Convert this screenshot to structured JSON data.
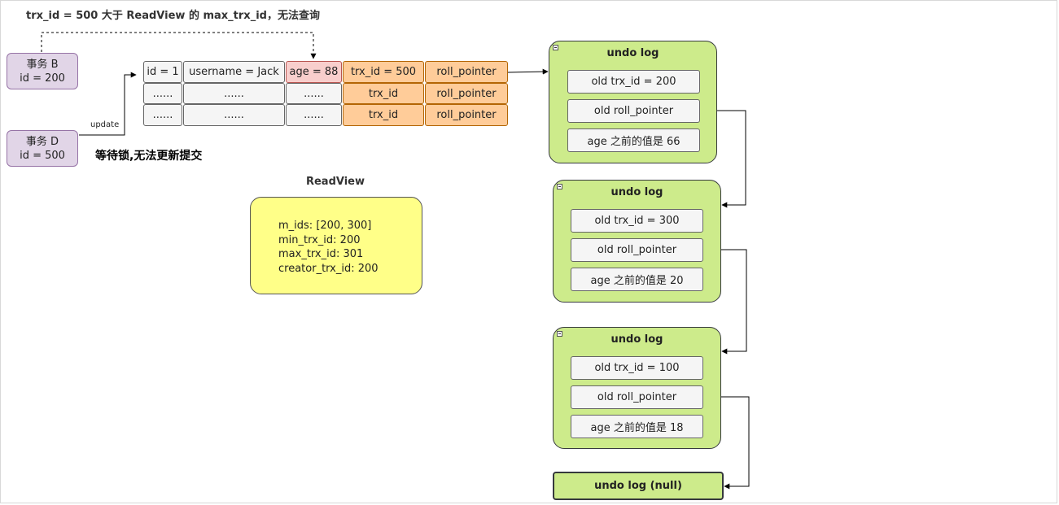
{
  "title": "trx_id = 500 大于 ReadView 的 max_trx_id，无法查询",
  "transactions": [
    {
      "name": "事务 B",
      "id": "id = 200"
    },
    {
      "name": "事务 D",
      "id": "id = 500"
    }
  ],
  "update_label": "update",
  "wait_note": "等待锁,无法更新提交",
  "table": {
    "rows": [
      [
        "id = 1",
        "username = Jack",
        "age = 88",
        "trx_id = 500",
        "roll_pointer"
      ],
      [
        "......",
        "......",
        "......",
        "trx_id",
        "roll_pointer"
      ],
      [
        "......",
        "......",
        "......",
        "trx_id",
        "roll_pointer"
      ]
    ]
  },
  "readview": {
    "title": "ReadView",
    "lines": [
      "m_ids: [200, 300]",
      "min_trx_id: 200",
      "max_trx_id: 301",
      "creator_trx_id: 200"
    ]
  },
  "undo_logs": [
    {
      "title": "undo log",
      "trx": "old trx_id = 200",
      "pointer": "old roll_pointer",
      "value": "age 之前的值是 66"
    },
    {
      "title": "undo log",
      "trx": "old trx_id = 300",
      "pointer": "old roll_pointer",
      "value": "age 之前的值是 20"
    },
    {
      "title": "undo log",
      "trx": "old trx_id = 100",
      "pointer": "old roll_pointer",
      "value": "age 之前的值是 18"
    }
  ],
  "undo_null": "undo log (null)",
  "colors": {
    "transaction_fill": "#e1d5e7",
    "transaction_stroke": "#9673a6",
    "cell_fill": "#f5f5f5",
    "age_fill": "#f8cecc",
    "trx_fill": "#ffcc99",
    "readview_fill": "#ffff88",
    "undo_fill": "#cdeb8b"
  }
}
